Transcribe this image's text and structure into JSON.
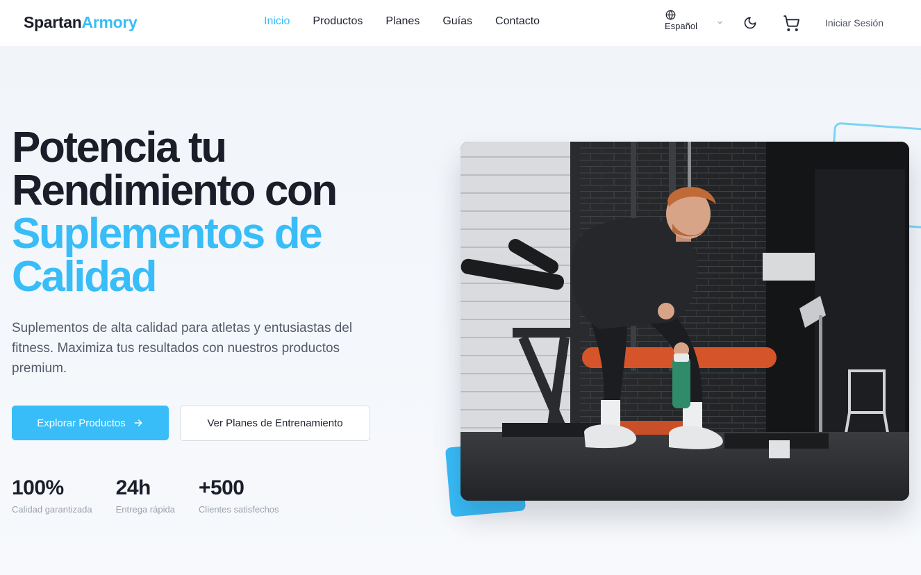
{
  "brand": {
    "part1": "Spartan",
    "part2": "Armory"
  },
  "nav": {
    "items": [
      {
        "label": "Inicio",
        "active": true
      },
      {
        "label": "Productos",
        "active": false
      },
      {
        "label": "Planes",
        "active": false
      },
      {
        "label": "Guías",
        "active": false
      },
      {
        "label": "Contacto",
        "active": false
      }
    ]
  },
  "header": {
    "language": "Español",
    "login": "Iniciar Sesión",
    "icons": [
      "globe-icon",
      "chevron-down-icon",
      "moon-icon",
      "cart-icon"
    ]
  },
  "hero": {
    "title_line1": "Potencia tu",
    "title_line2": "Rendimiento con",
    "title_highlight1": "Suplementos de",
    "title_highlight2": "Calidad",
    "description": "Suplementos de alta calidad para atletas y entusiastas del fitness. Maximiza tus resultados con nuestros productos premium.",
    "primary_button": "Explorar Productos",
    "secondary_button": "Ver Planes de Entrenamiento"
  },
  "stats": [
    {
      "value": "100%",
      "label": "Calidad garantizada"
    },
    {
      "value": "24h",
      "label": "Entrega rápida"
    },
    {
      "value": "+500",
      "label": "Clientes satisfechos"
    }
  ],
  "colors": {
    "accent": "#38bdf8",
    "text_dark": "#1b1e29",
    "text_muted": "#545a6a",
    "background": "#f7f9fc"
  }
}
